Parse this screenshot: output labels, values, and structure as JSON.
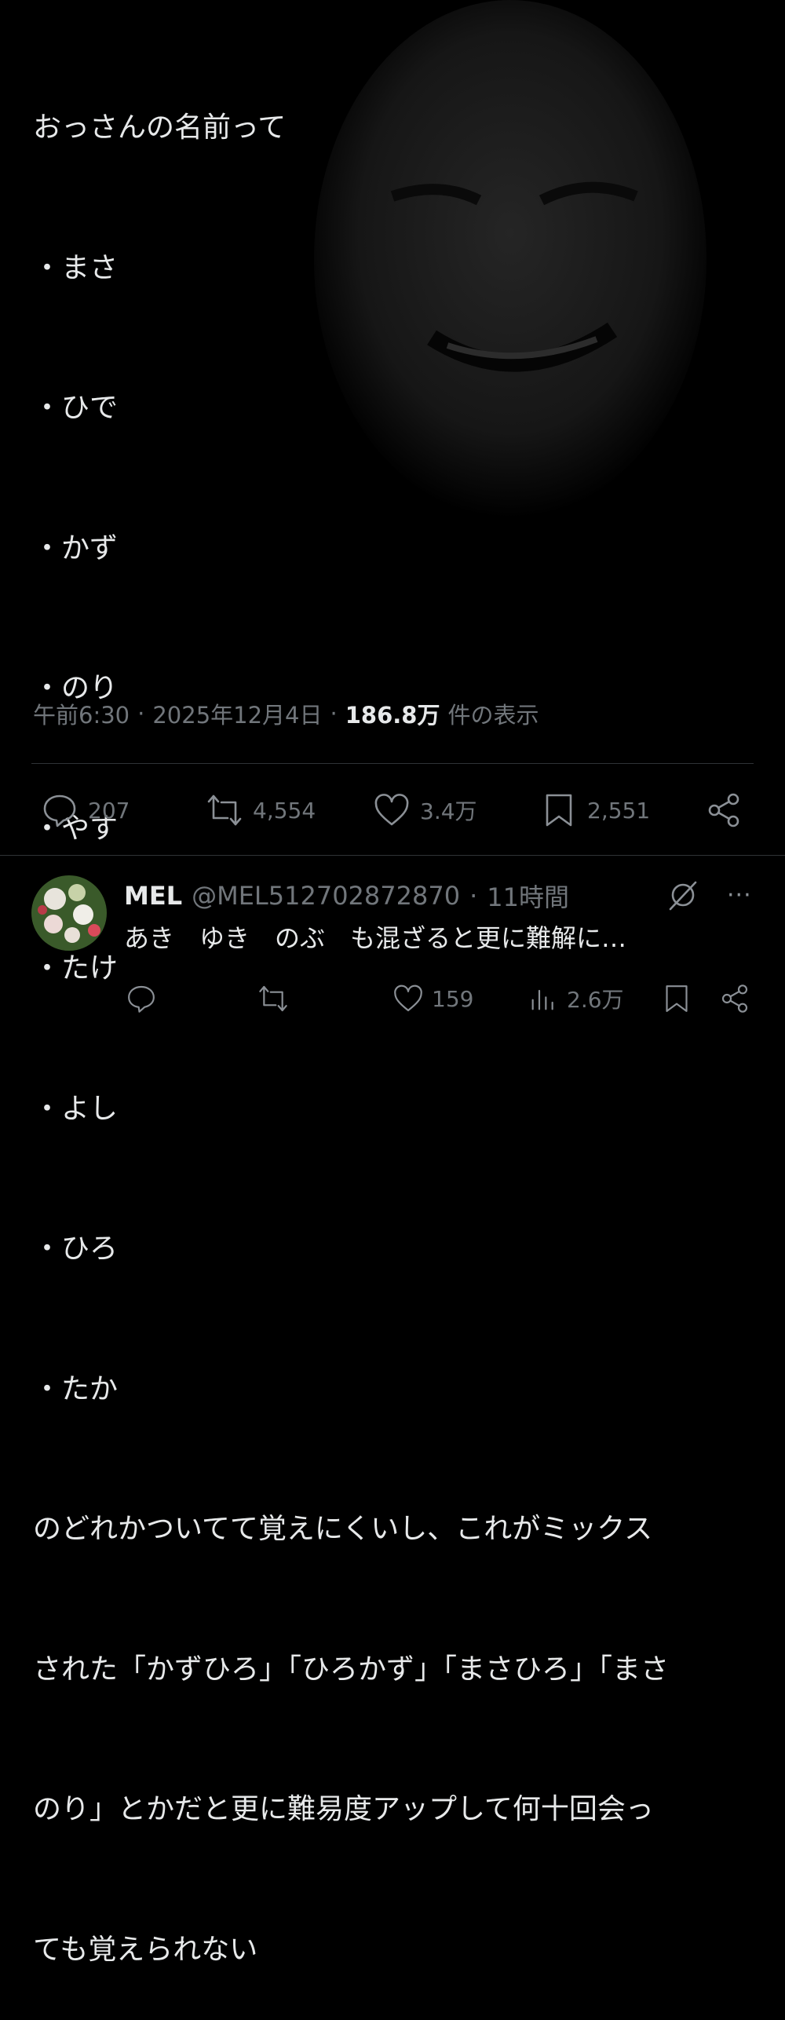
{
  "tweet": {
    "lines": [
      "おっさんの名前って",
      "・まさ",
      "・ひで",
      "・かず",
      "・のり",
      "・やす",
      "・たけ",
      "・よし",
      "・ひろ",
      "・たか",
      "のどれかついてて覚えにくいし、これがミックス",
      "された「かずひろ」「ひろかず」「まさひろ」「まさ",
      "のり」とかだと更に難易度アップして何十回会っ",
      "ても覚えられない"
    ],
    "time": "午前6:30",
    "date": "2025年12月4日",
    "views_count": "186.8万",
    "views_label": "件の表示",
    "separator": "·"
  },
  "actions": {
    "replies": "207",
    "reposts": "4,554",
    "likes": "3.4万",
    "bookmarks": "2,551"
  },
  "reply": {
    "name": "MEL",
    "handle": "@MEL512702872870",
    "time": "11時間",
    "separator": "·",
    "text": "あき　ゆき　のぶ　も混ざると更に難解に…",
    "more": "···",
    "likes": "159",
    "views": "2.6万"
  },
  "icons": {
    "reply": "reply-bubble-icon",
    "repost": "repost-icon",
    "like": "heart-icon",
    "bookmark": "bookmark-icon",
    "share": "share-icon",
    "views": "analytics-icon",
    "grok": "grok-icon"
  }
}
